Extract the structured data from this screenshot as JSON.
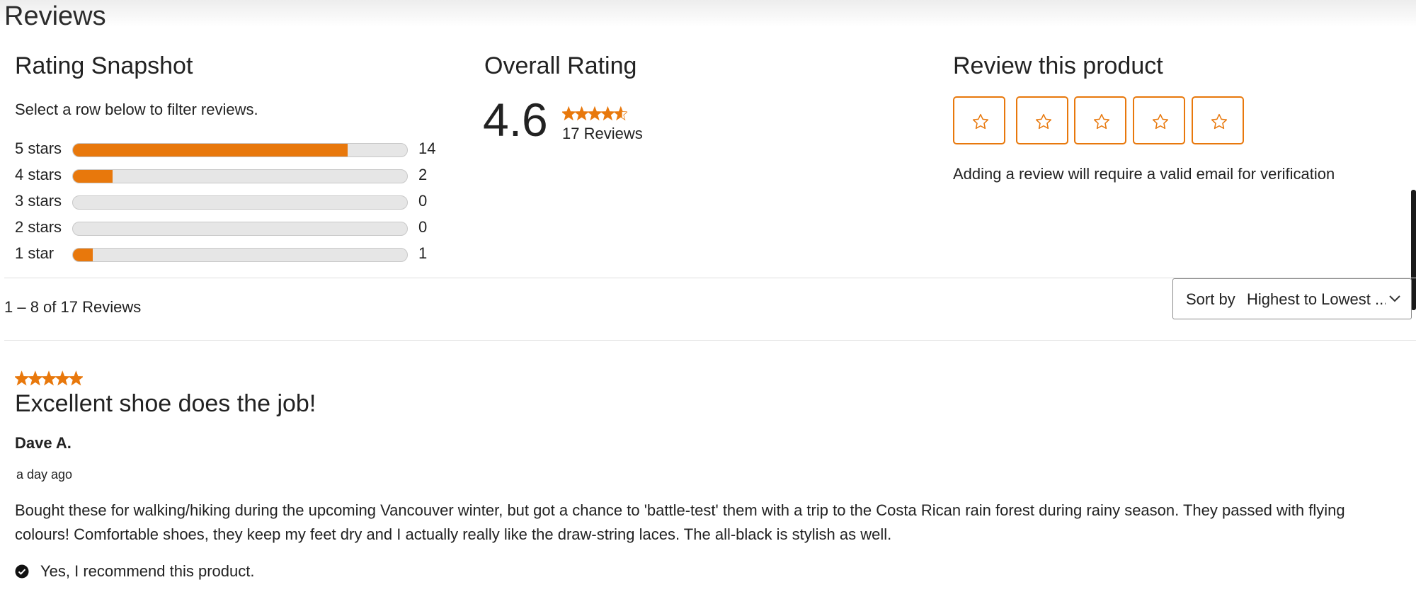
{
  "page": {
    "title": "Reviews"
  },
  "colors": {
    "accent": "#e8780c",
    "track": "#e6e6e6",
    "text": "#222222"
  },
  "snapshot": {
    "heading": "Rating Snapshot",
    "hint": "Select a row below to filter reviews.",
    "rows": [
      {
        "label": "5 stars",
        "count": "14",
        "fraction": 0.823
      },
      {
        "label": "4 stars",
        "count": "2",
        "fraction": 0.118
      },
      {
        "label": "3 stars",
        "count": "0",
        "fraction": 0
      },
      {
        "label": "2 stars",
        "count": "0",
        "fraction": 0
      },
      {
        "label": "1 star",
        "count": "1",
        "fraction": 0.059
      }
    ]
  },
  "overall": {
    "heading": "Overall Rating",
    "average": "4.6",
    "rating_value": 4.6,
    "count_text": "17 Reviews",
    "icon": "star-rating-icon"
  },
  "write": {
    "heading": "Review this product",
    "star_icon": "star-outline-icon",
    "stars": 5,
    "note": "Adding a review will require a valid email for verification"
  },
  "toolbar": {
    "pagination": "1 – 8 of 17 Reviews",
    "sort_label": "Sort by",
    "sort_value": "Highest to Lowest Rating",
    "sort_icon": "chevron-down-icon"
  },
  "review": {
    "rating_value": 5,
    "title": "Excellent shoe does the job!",
    "author": "Dave A.",
    "date": "a day ago",
    "body": "Bought these for walking/hiking during the upcoming Vancouver winter, but got a chance to 'battle-test' them with a trip to the Costa Rican rain forest during rainy season. They passed with flying colours! Comfortable shoes, they keep my feet dry and I actually really like the draw-string laces. The all-black is stylish as well.",
    "recommend": "Yes, I recommend this product.",
    "recommend_icon": "check-circle-icon"
  }
}
